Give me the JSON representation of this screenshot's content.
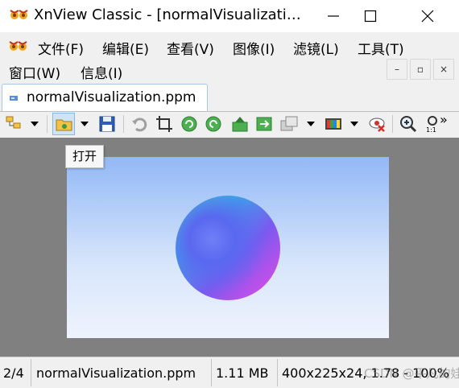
{
  "window": {
    "title": "XnView Classic - [normalVisualizati…",
    "minimize_icon": "minimize-icon",
    "maximize_icon": "maximize-icon",
    "close_icon": "close-icon"
  },
  "menu": {
    "items": [
      {
        "label": "文件(F)"
      },
      {
        "label": "编辑(E)"
      },
      {
        "label": "查看(V)"
      },
      {
        "label": "图像(I)"
      },
      {
        "label": "滤镜(L)"
      },
      {
        "label": "工具(T)"
      },
      {
        "label": "窗口(W)"
      },
      {
        "label": "信息(I)"
      }
    ],
    "mdi_buttons": [
      "–",
      "▫",
      "×"
    ]
  },
  "tab": {
    "label": "normalVisualization.ppm"
  },
  "toolbar": {
    "tooltip": "打开",
    "more": "»"
  },
  "status": {
    "index": "2/4",
    "filename": "normalVisualization.ppm",
    "filesize": "1.11 MB",
    "dimensions": "400x225x24, 1.78 - 100%"
  },
  "watermark": "CSDN @平凡的娃"
}
